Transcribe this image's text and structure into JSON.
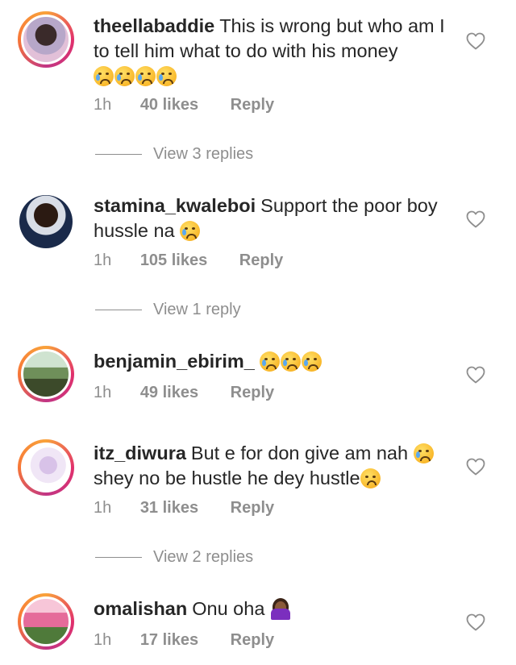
{
  "comments": [
    {
      "username": "theellabaddie",
      "text": "This is wrong but who am I to tell him what to do with his money",
      "emojis": [
        "crying-face",
        "crying-face",
        "crying-face",
        "crying-face"
      ],
      "time": "1h",
      "likes": "40 likes",
      "reply_label": "Reply",
      "view_replies": "View 3 replies"
    },
    {
      "username": "stamina_kwaleboi",
      "text": "Support the poor boy hussle na",
      "emojis": [
        "crying-face"
      ],
      "time": "1h",
      "likes": "105 likes",
      "reply_label": "Reply",
      "view_replies": "View 1 reply"
    },
    {
      "username": "benjamin_ebirim_",
      "text": "",
      "emojis": [
        "crying-face",
        "crying-face",
        "crying-face"
      ],
      "time": "1h",
      "likes": "49 likes",
      "reply_label": "Reply"
    },
    {
      "username": "itz_diwura",
      "text": "But e for don give am nah",
      "text2": "shey no be hustle he dey hustle",
      "emojis": [
        "crying-face"
      ],
      "emojis2": [
        "worried-face"
      ],
      "time": "1h",
      "likes": "31 likes",
      "reply_label": "Reply",
      "view_replies": "View 2 replies"
    },
    {
      "username": "omalishan",
      "text": "Onu oha",
      "emojis": [
        "woman-facepalming"
      ],
      "time": "1h",
      "likes": "17 likes",
      "reply_label": "Reply"
    }
  ],
  "colors": {
    "text": "#262626",
    "muted": "#8e8e8e",
    "story_ring": "#e1306c"
  }
}
